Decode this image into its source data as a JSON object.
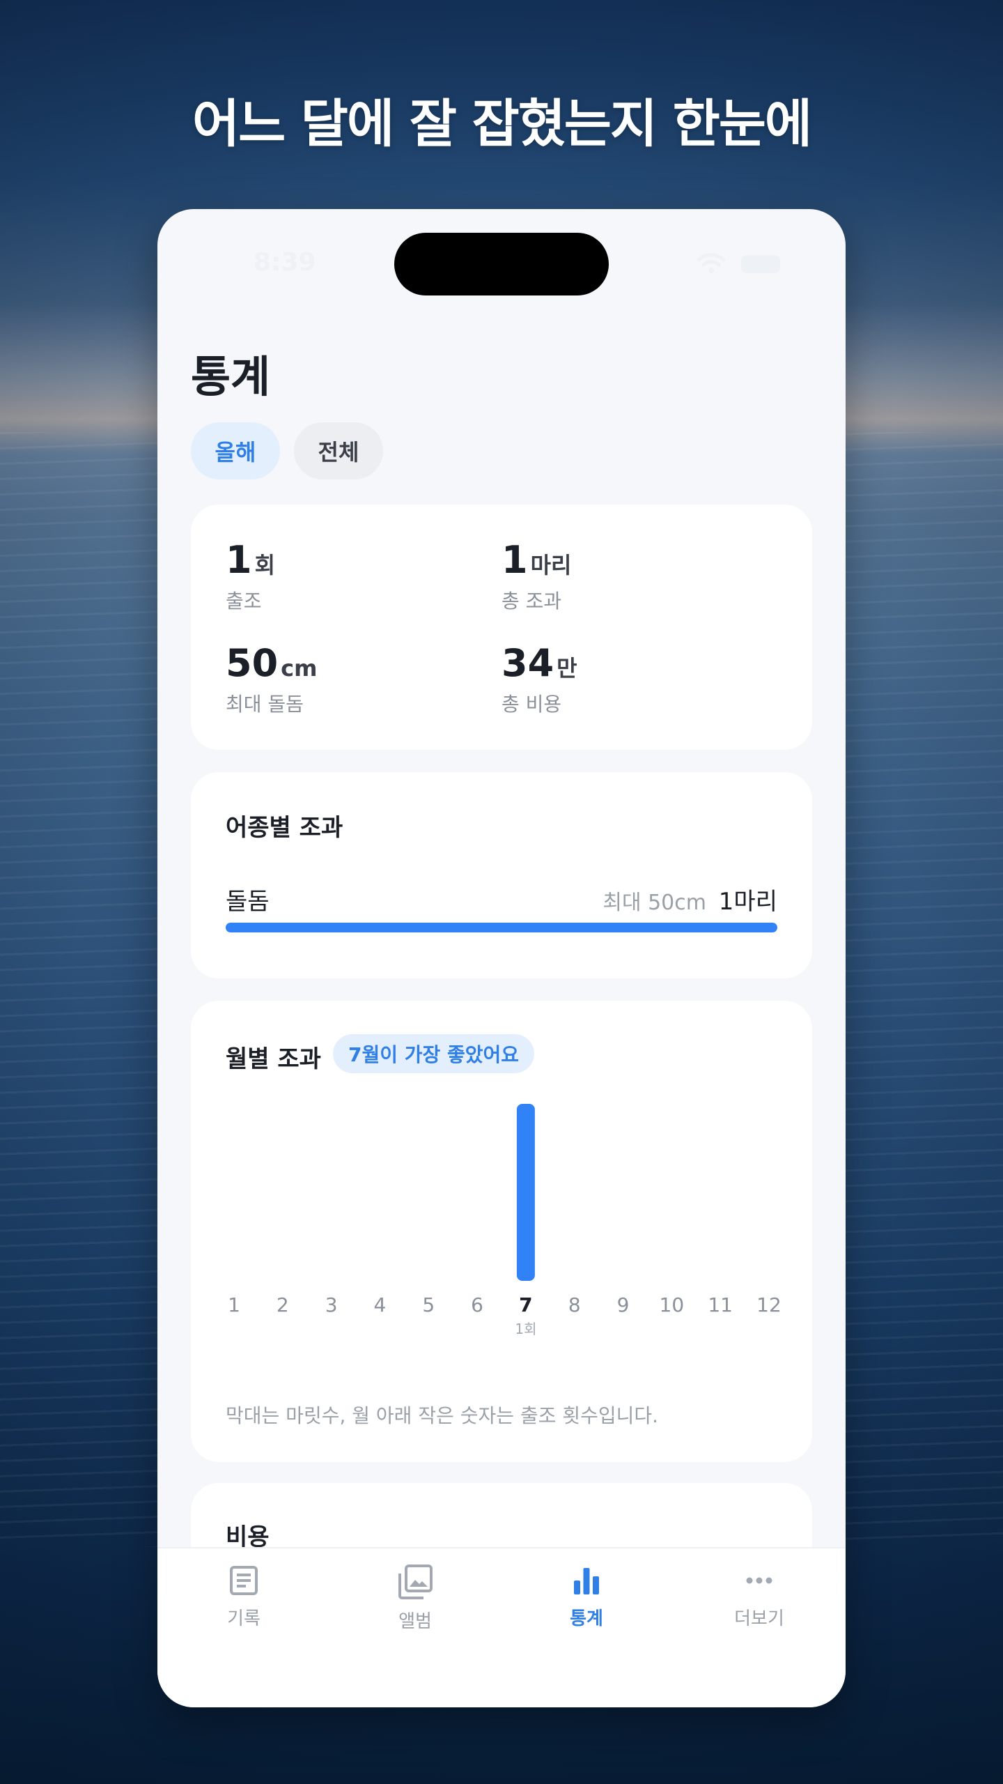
{
  "headline": "어느 달에 잘 잡혔는지 한눈에",
  "status_bar": {
    "time": "8:39"
  },
  "page_title": "통계",
  "tabs": [
    {
      "label": "올해",
      "active": true
    },
    {
      "label": "전체",
      "active": false
    }
  ],
  "summary": {
    "trips": {
      "value": "1",
      "unit": "회",
      "label": "출조"
    },
    "total_catch": {
      "value": "1",
      "unit": "마리",
      "label": "총 조과"
    },
    "max_size": {
      "value": "50",
      "unit": "cm",
      "label": "최대 돌돔"
    },
    "total_cost": {
      "value": "34",
      "unit": "만",
      "label": "총 비용"
    }
  },
  "species_section": {
    "title": "어종별 조과",
    "items": [
      {
        "name": "돌돔",
        "max": "최대 50cm",
        "count": "1마리",
        "fraction": 1.0
      }
    ]
  },
  "monthly_section": {
    "title": "월별 조과",
    "badge": "7월이 가장 좋았어요",
    "note": "막대는 마릿수, 월 아래 작은 숫자는 출조 횟수입니다.",
    "accent": "#3182f6"
  },
  "chart_data": {
    "type": "bar",
    "categories": [
      "1",
      "2",
      "3",
      "4",
      "5",
      "6",
      "7",
      "8",
      "9",
      "10",
      "11",
      "12"
    ],
    "values": [
      0,
      0,
      0,
      0,
      0,
      0,
      1,
      0,
      0,
      0,
      0,
      0
    ],
    "value_labels": [
      "",
      "",
      "",
      "",
      "",
      "",
      "1",
      "",
      "",
      "",
      "",
      ""
    ],
    "sublabels": [
      "",
      "",
      "",
      "",
      "",
      "",
      "1회",
      "",
      "",
      "",
      "",
      ""
    ],
    "highlight_index": 6,
    "title": "월별 조과",
    "ylim": [
      0,
      1
    ]
  },
  "cost_section": {
    "title": "비용"
  },
  "tabbar": [
    {
      "label": "기록",
      "icon": "document-icon",
      "active": false
    },
    {
      "label": "앨범",
      "icon": "album-icon",
      "active": false
    },
    {
      "label": "통계",
      "icon": "bar-chart-icon",
      "active": true
    },
    {
      "label": "더보기",
      "icon": "more-icon",
      "active": false
    }
  ]
}
